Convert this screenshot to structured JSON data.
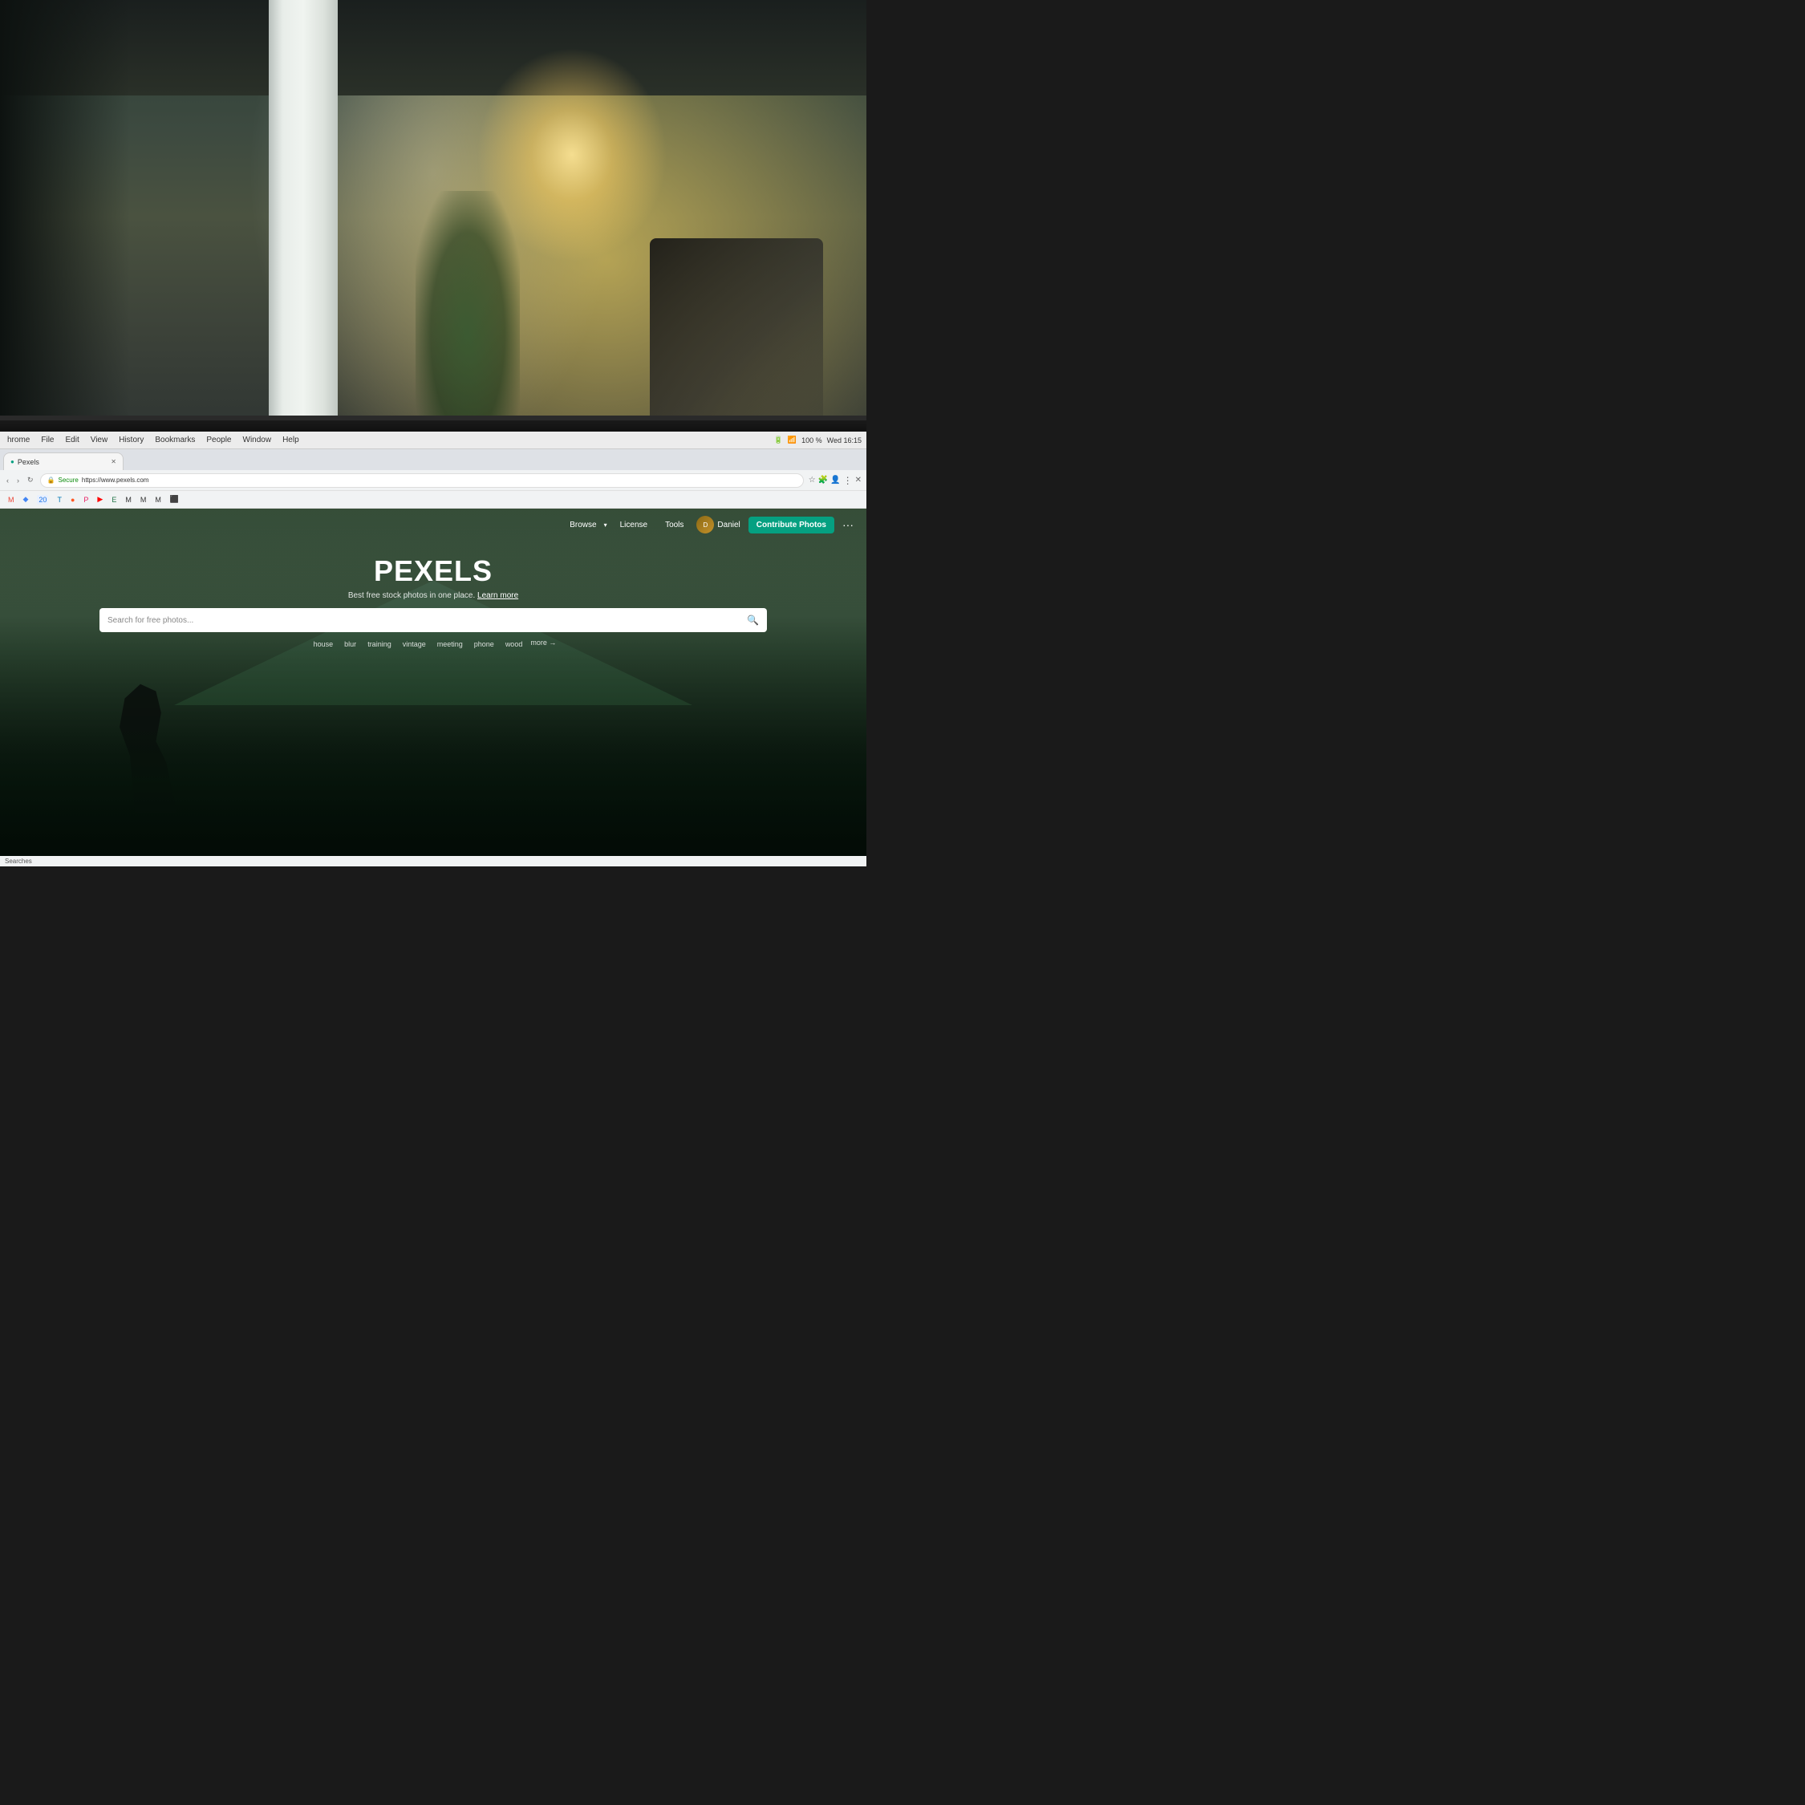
{
  "background": {
    "alt": "Office interior with natural light"
  },
  "browser": {
    "menu_items": [
      "hrome",
      "File",
      "Edit",
      "View",
      "History",
      "Bookmarks",
      "People",
      "Window",
      "Help"
    ],
    "status_right": "100 %",
    "time": "Wed 16:15",
    "tab_label": "Pexels",
    "url_secure": "Secure",
    "url": "https://www.pexels.com",
    "back_btn": "‹",
    "forward_btn": "›",
    "refresh_btn": "↻"
  },
  "bookmarks": [
    {
      "label": "M",
      "color": "#EA4335"
    },
    {
      "label": "◆",
      "color": "#4285F4"
    },
    {
      "label": "20",
      "color": "#1a73e8"
    },
    {
      "label": "T",
      "color": "#0077b5"
    },
    {
      "label": "●",
      "color": "#ff5722"
    },
    {
      "label": "P",
      "color": "#e91e63"
    },
    {
      "label": "▶",
      "color": "#ff0000"
    },
    {
      "label": "E",
      "color": "#217346"
    },
    {
      "label": "M",
      "color": "#0f9d58"
    },
    {
      "label": "M",
      "color": "#0077cc"
    }
  ],
  "pexels": {
    "nav": {
      "browse_label": "Browse",
      "license_label": "License",
      "tools_label": "Tools",
      "user_name": "Daniel",
      "contribute_label": "Contribute Photos",
      "more_label": "···"
    },
    "hero": {
      "logo": "PEXELS",
      "tagline": "Best free stock photos in one place.",
      "learn_more": "Learn more",
      "search_placeholder": "Search for free photos...",
      "tags": [
        "house",
        "blur",
        "training",
        "vintage",
        "meeting",
        "phone",
        "wood"
      ],
      "more_tag": "more →"
    }
  },
  "status_bar": {
    "searches_label": "Searches"
  }
}
